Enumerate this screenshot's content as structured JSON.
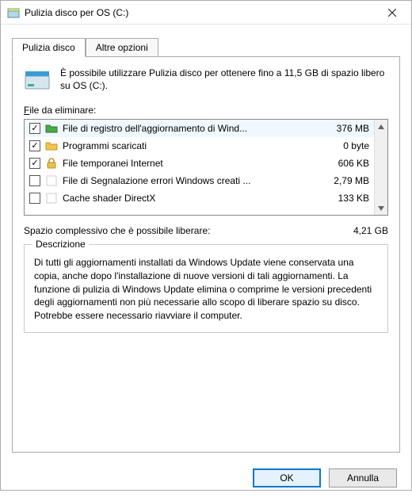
{
  "window": {
    "title": "Pulizia disco per OS (C:)"
  },
  "tabs": {
    "active": "Pulizia disco",
    "other": "Altre opzioni"
  },
  "intro": "È possibile utilizzare Pulizia disco per ottenere fino a 11,5 GB di spazio libero su OS (C:).",
  "filesLabelPrefix": "F",
  "filesLabelRest": "ile da eliminare:",
  "files": [
    {
      "checked": true,
      "icon": "folder-green",
      "name": "File di registro dell'aggiornamento di Wind...",
      "size": "376 MB"
    },
    {
      "checked": true,
      "icon": "folder-yellow",
      "name": "Programmi scaricati",
      "size": "0 byte"
    },
    {
      "checked": true,
      "icon": "lock",
      "name": "File temporanei Internet",
      "size": "606 KB"
    },
    {
      "checked": false,
      "icon": "blank",
      "name": "File di Segnalazione errori Windows creati ...",
      "size": "2,79 MB"
    },
    {
      "checked": false,
      "icon": "blank",
      "name": "Cache shader DirectX",
      "size": "133 KB"
    }
  ],
  "totals": {
    "label": "Spazio complessivo che è possibile liberare:",
    "value": "4,21 GB"
  },
  "description": {
    "title": "Descrizione",
    "text": "Di tutti gli aggiornamenti installati da Windows Update viene conservata una copia, anche dopo l'installazione di nuove versioni di tali aggiornamenti. La funzione di pulizia di Windows Update elimina o comprime le versioni precedenti degli aggiornamenti non più necessarie allo scopo di liberare spazio su disco. Potrebbe essere necessario riavviare il computer."
  },
  "buttons": {
    "ok": "OK",
    "cancel": "Annulla"
  }
}
